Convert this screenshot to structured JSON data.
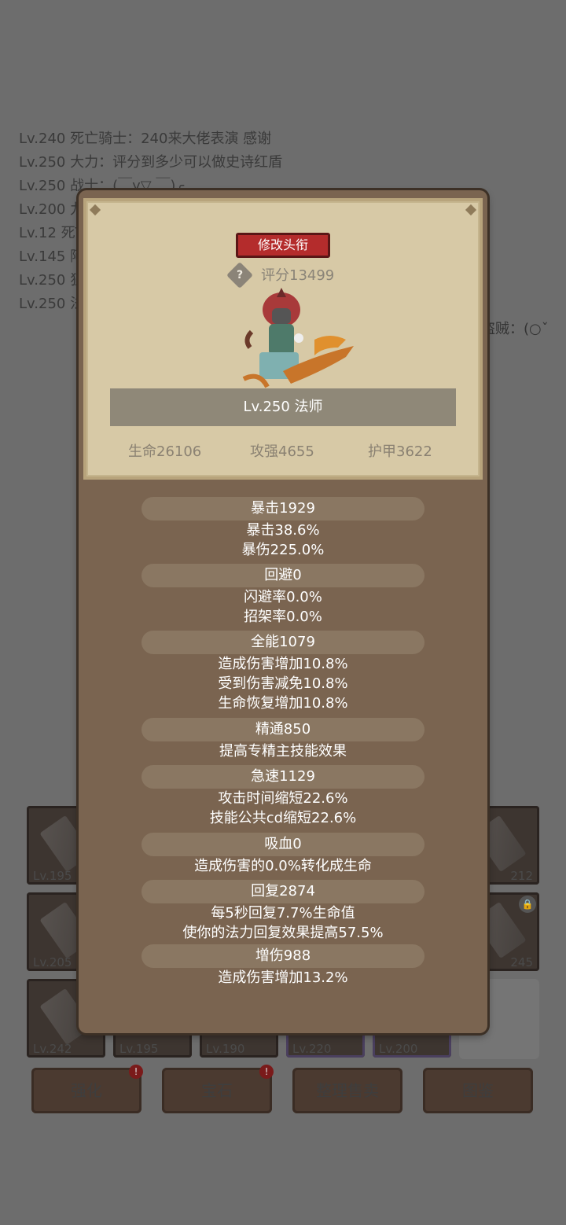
{
  "chat": [
    "Lv.240 死亡骑士：240来大佬表演 感谢",
    "Lv.250 大力：评分到多少可以做史诗红盾",
    "Lv.250 战士：(￣y▽,￣)╭",
    "Lv.200 九",
    "Lv.12 死T",
    "Lv.145 阿",
    "Lv.250 狂",
    "Lv.250 法"
  ],
  "side_text": "盗贼：(○ˇ",
  "inventory": [
    {
      "lv": "Lv.195"
    },
    {
      "lv": "212"
    },
    {
      "lv": "Lv.205"
    },
    {
      "lv": "245"
    },
    {
      "lv": "Lv.242"
    },
    {
      "lv": "Lv.195"
    },
    {
      "lv": "Lv.190"
    },
    {
      "lv": "Lv.220"
    },
    {
      "lv": "Lv.200"
    }
  ],
  "bottom_buttons": [
    "强化",
    "宝石",
    "整理售卖",
    "图鉴"
  ],
  "badge_symbol": "!",
  "modal": {
    "edit_title_label": "修改头衔",
    "help_symbol": "?",
    "score": "评分13499",
    "character": "Lv.250 法师",
    "base_stats": [
      "生命26106",
      "攻强4655",
      "护甲3622"
    ],
    "groups": [
      {
        "title": "暴击1929",
        "lines": [
          "暴击38.6%",
          "暴伤225.0%"
        ]
      },
      {
        "title": "回避0",
        "lines": [
          "闪避率0.0%",
          "招架率0.0%"
        ]
      },
      {
        "title": "全能1079",
        "lines": [
          "造成伤害增加10.8%",
          "受到伤害减免10.8%",
          "生命恢复增加10.8%"
        ]
      },
      {
        "title": "精通850",
        "lines": [
          "提高专精主技能效果"
        ]
      },
      {
        "title": "急速1129",
        "lines": [
          "攻击时间缩短22.6%",
          "技能公共cd缩短22.6%"
        ]
      },
      {
        "title": "吸血0",
        "lines": [
          "造成伤害的0.0%转化成生命"
        ]
      },
      {
        "title": "回复2874",
        "lines": [
          "每5秒回复7.7%生命值",
          "使你的法力回复效果提高57.5%"
        ]
      },
      {
        "title": "增伤988",
        "lines": [
          "造成伤害增加13.2%"
        ]
      }
    ]
  }
}
